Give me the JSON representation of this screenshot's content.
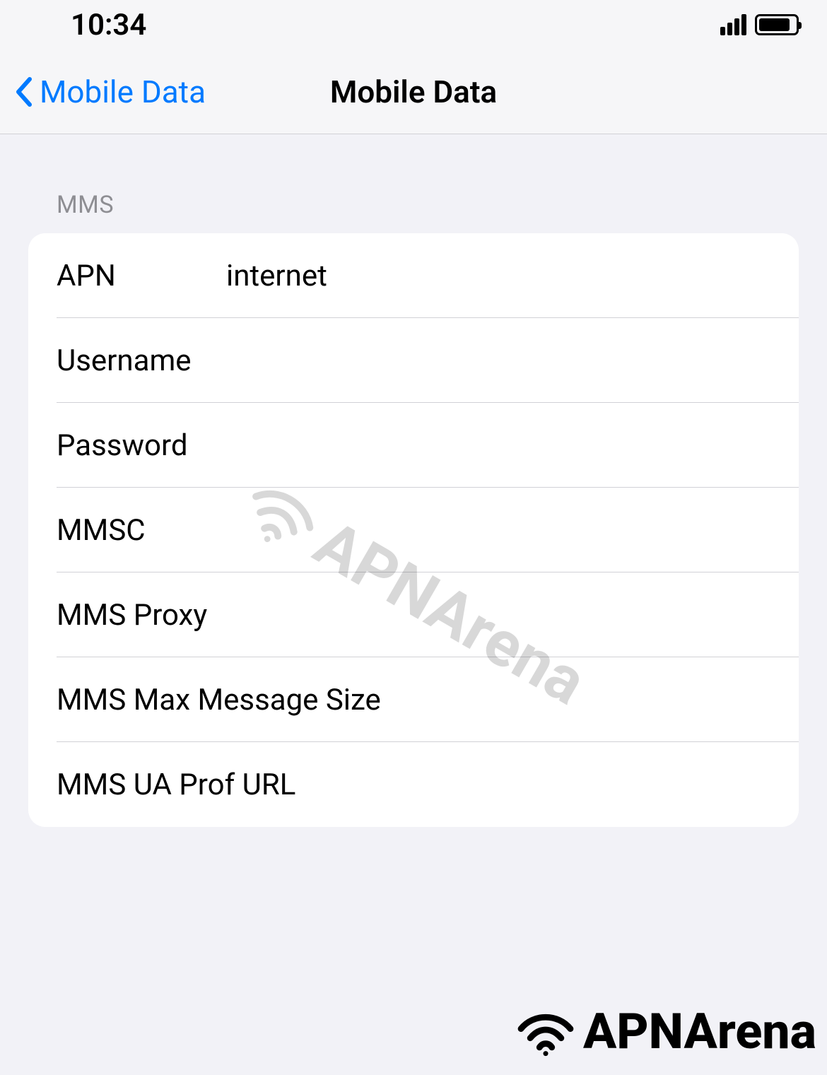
{
  "statusBar": {
    "time": "10:34"
  },
  "navBar": {
    "backLabel": "Mobile Data",
    "title": "Mobile Data"
  },
  "section": {
    "header": "MMS",
    "rows": {
      "apn": {
        "label": "APN",
        "value": "internet"
      },
      "username": {
        "label": "Username",
        "value": ""
      },
      "password": {
        "label": "Password",
        "value": ""
      },
      "mmsc": {
        "label": "MMSC",
        "value": ""
      },
      "mmsProxy": {
        "label": "MMS Proxy",
        "value": ""
      },
      "mmsMaxSize": {
        "label": "MMS Max Message Size",
        "value": ""
      },
      "mmsUaProf": {
        "label": "MMS UA Prof URL",
        "value": ""
      }
    }
  },
  "watermark": {
    "text": "APNArena"
  }
}
